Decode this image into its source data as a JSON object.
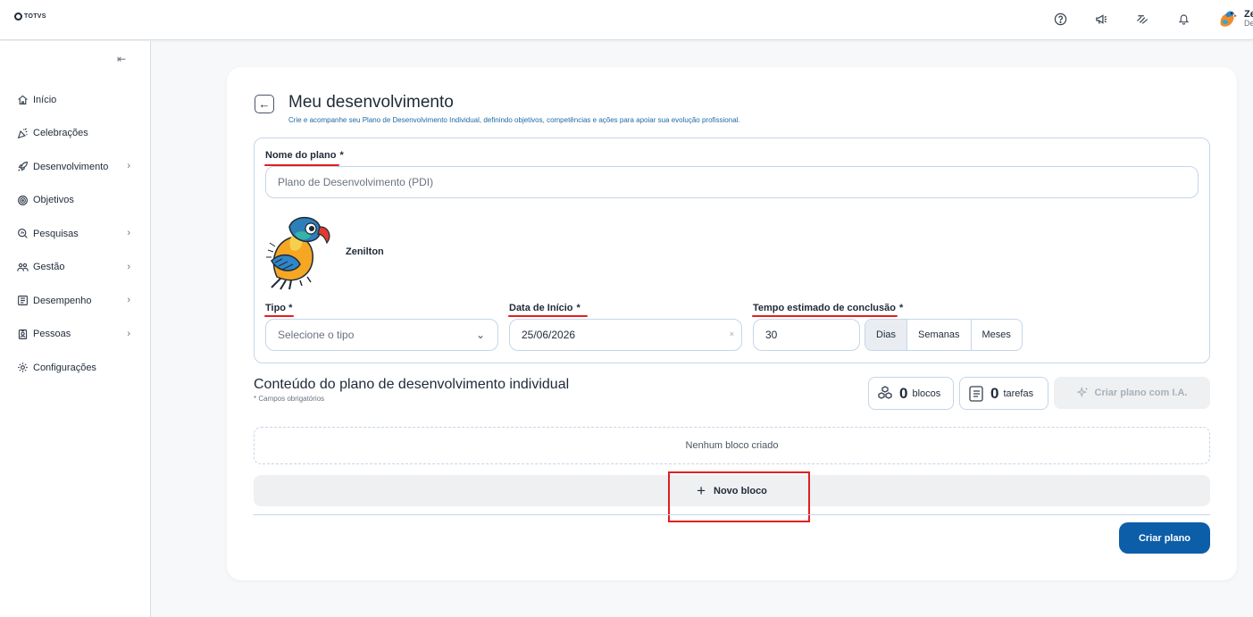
{
  "topbar": {
    "logo_text": "TOTVS",
    "icons": [
      "help-icon",
      "megaphone-icon",
      "sign-language-icon",
      "bell-icon"
    ],
    "user_initial": "Ze",
    "user_sub": "De"
  },
  "sidebar": {
    "items": [
      {
        "label": "Início",
        "icon": "home-icon",
        "chevron": false
      },
      {
        "label": "Celebrações",
        "icon": "party-icon",
        "chevron": false
      },
      {
        "label": "Desenvolvimento",
        "icon": "rocket-icon",
        "chevron": true
      },
      {
        "label": "Objetivos",
        "icon": "target-icon",
        "chevron": false
      },
      {
        "label": "Pesquisas",
        "icon": "search-icon",
        "chevron": true
      },
      {
        "label": "Gestão",
        "icon": "people-icon",
        "chevron": true
      },
      {
        "label": "Desempenho",
        "icon": "scorecard-icon",
        "chevron": true
      },
      {
        "label": "Pessoas",
        "icon": "badge-icon",
        "chevron": true
      },
      {
        "label": "Configurações",
        "icon": "gear-icon",
        "chevron": false
      }
    ]
  },
  "page": {
    "title": "Meu desenvolvimento",
    "subtitle": "Crie e acompanhe seu Plano de Desenvolvimento Individual, definindo objetivos, competências e ações para apoiar sua evolução profissional."
  },
  "form": {
    "plan_name_label": "Nome do plano",
    "plan_name_req": "*",
    "plan_name_placeholder": "Plano de Desenvolvimento (PDI)",
    "person_name": "Zenilton",
    "type_label": "Tipo *",
    "type_placeholder": "Selecione o tipo",
    "start_date_label": "Data de Início",
    "start_date_req": "*",
    "start_date_value": "25/06/2026",
    "duration_label": "Tempo estimado de conclusão",
    "duration_req": "*",
    "duration_value": "30",
    "duration_units": [
      "Dias",
      "Semanas",
      "Meses"
    ],
    "duration_selected": "Dias"
  },
  "content": {
    "title": "Conteúdo do plano de desenvolvimento individual",
    "note": "* Campos obrigatórios",
    "blocks_count": "0",
    "blocks_label": "blocos",
    "tasks_count": "0",
    "tasks_label": "tarefas",
    "ai_button": "Criar plano com I.A.",
    "empty_text": "Nenhum bloco criado",
    "new_block": "Novo bloco",
    "create_button": "Criar plano"
  },
  "colors": {
    "accent": "#0c5ea8",
    "annotation_red": "#e21f1f",
    "border": "#c5d6e8"
  }
}
